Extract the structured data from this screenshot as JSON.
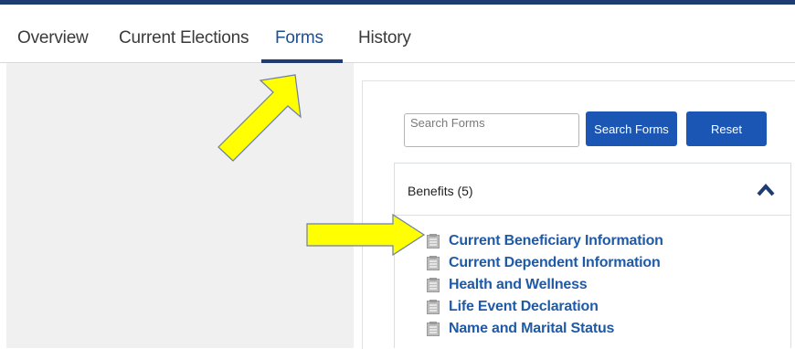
{
  "tabs": [
    {
      "label": "Overview"
    },
    {
      "label": "Current Elections"
    },
    {
      "label": "Forms"
    },
    {
      "label": "History"
    }
  ],
  "active_tab": "Forms",
  "search": {
    "placeholder": "Search Forms",
    "value": "",
    "search_button_label": "Search Forms",
    "reset_button_label": "Reset"
  },
  "benefits_panel": {
    "title": "Benefits (5)",
    "forms": [
      {
        "label": "Current Beneficiary Information"
      },
      {
        "label": "Current Dependent Information"
      },
      {
        "label": "Health and Wellness"
      },
      {
        "label": "Life Event Declaration"
      },
      {
        "label": "Name and Marital Status"
      }
    ]
  },
  "icons": {
    "form_item": "document-icon",
    "panel_toggle": "chevron-up-icon",
    "annotation": "yellow-arrow"
  },
  "colors": {
    "top_bar": "#1f3b74",
    "active_tab": "#1f4f8f",
    "button": "#1b56b4",
    "link": "#1f5aa6",
    "annotation_arrow": "#ffff00"
  }
}
